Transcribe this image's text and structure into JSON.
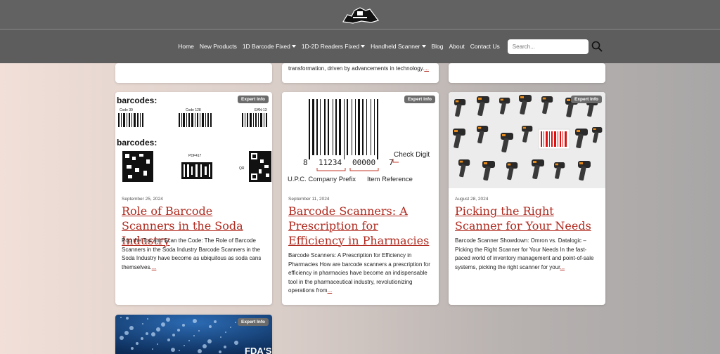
{
  "nav": {
    "items": [
      {
        "label": "Home",
        "dropdown": false
      },
      {
        "label": "New Products",
        "dropdown": false
      },
      {
        "label": "1D Barcode Fixed",
        "dropdown": true
      },
      {
        "label": "1D-2D Readers Fixed",
        "dropdown": true
      },
      {
        "label": "Handheld Scanner",
        "dropdown": true
      },
      {
        "label": "Blog",
        "dropdown": false
      },
      {
        "label": "About",
        "dropdown": false
      },
      {
        "label": "Contact Us",
        "dropdown": false
      }
    ],
    "search_placeholder": "Search..."
  },
  "top_cards": {
    "middle_excerpt": "transformation, driven by advancements in technology.",
    "more": "..."
  },
  "cards": [
    {
      "badge": "Expert Info",
      "date": "September 25, 2024",
      "title": "Role of Barcode Scanners in the Soda Industry",
      "excerpt": "Pop the Top and Scan the Code: The Role of Barcode Scanners in the Soda Industry Barcode Scanners in the Soda Industry have become as ubiquitous as soda cans themselves.",
      "more": "...",
      "image_labels": {
        "heading1": "barcodes:",
        "heading2": "barcodes:",
        "l1": "Code 39",
        "l2": "Code 128",
        "l3": "EAN-13",
        "l4": "PDF417",
        "l5": "QR"
      }
    },
    {
      "badge": "Expert Info",
      "date": "September 11, 2024",
      "title": "Barcode Scanners: A Prescription for Efficiency in Pharmacies",
      "excerpt": "Barcode Scanners: A Prescription for Efficiency in Pharmacies How are barcode scanners a prescription for efficiency in pharmacies have become an indispensable tool in the pharmaceutical industry, revolutionizing operations from",
      "more": "...",
      "image_labels": {
        "check": "Check Digit",
        "prefix": "U.P.C. Company Prefix",
        "ref": "Item Reference",
        "d1": "8",
        "d2": "11234",
        "d3": "00000",
        "d4": "7"
      }
    },
    {
      "badge": "Expert Info",
      "date": "August 28, 2024",
      "title": "Picking the Right Scanner for Your Needs",
      "excerpt": "Barcode Scanner Showdown: Omron vs. Datalogic – Picking the Right Scanner for Your Needs In the fast-paced world of inventory management and point-of-sale systems, picking the right scanner for your",
      "more": "..."
    }
  ],
  "bottom_card": {
    "badge": "Expert Info",
    "image_text": "FDA'S"
  },
  "colors": {
    "accent": "#b02a1f",
    "header": "#5d5d5d",
    "badge": "#6b6b6b"
  }
}
